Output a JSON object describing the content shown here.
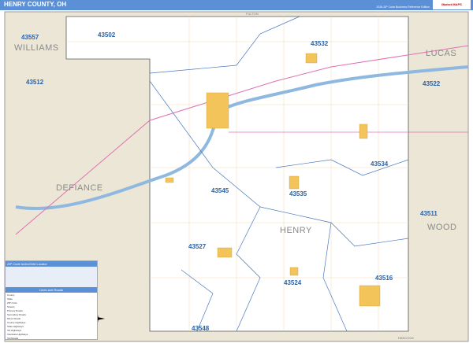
{
  "header": {
    "title": "HENRY COUNTY, OH",
    "edition": "2026 ZIP Code Business Reference Edition",
    "logo": "Market MAPS"
  },
  "counties": {
    "henry": "HENRY",
    "williams": "WILLIAMS",
    "defiance": "DEFIANCE",
    "lucas": "LUCAS",
    "wood": "WOOD",
    "fulton": "FULTON",
    "hancock": "HANCOCK"
  },
  "zips": [
    "43502",
    "43557",
    "43532",
    "43512",
    "43522",
    "43534",
    "43545",
    "43535",
    "43511",
    "43527",
    "43524",
    "43516",
    "43548"
  ],
  "legend": {
    "title": "ZIP Code Index/Grid Locator",
    "section": "Lines and Roads",
    "items": [
      "County",
      "State",
      "ZIP Code",
      "Streets",
      "Primary Roads",
      "Secondary Roads",
      "Minor Roads",
      "County Highways",
      "State Highways",
      "US Highways",
      "Interstate Highways",
      "Toll Roads"
    ]
  },
  "colors": {
    "header": "#5b8fd6",
    "zip": "#2a63a8",
    "outside": "#ece6d7",
    "water": "#8fb8e0",
    "city": "#f2c45a"
  }
}
